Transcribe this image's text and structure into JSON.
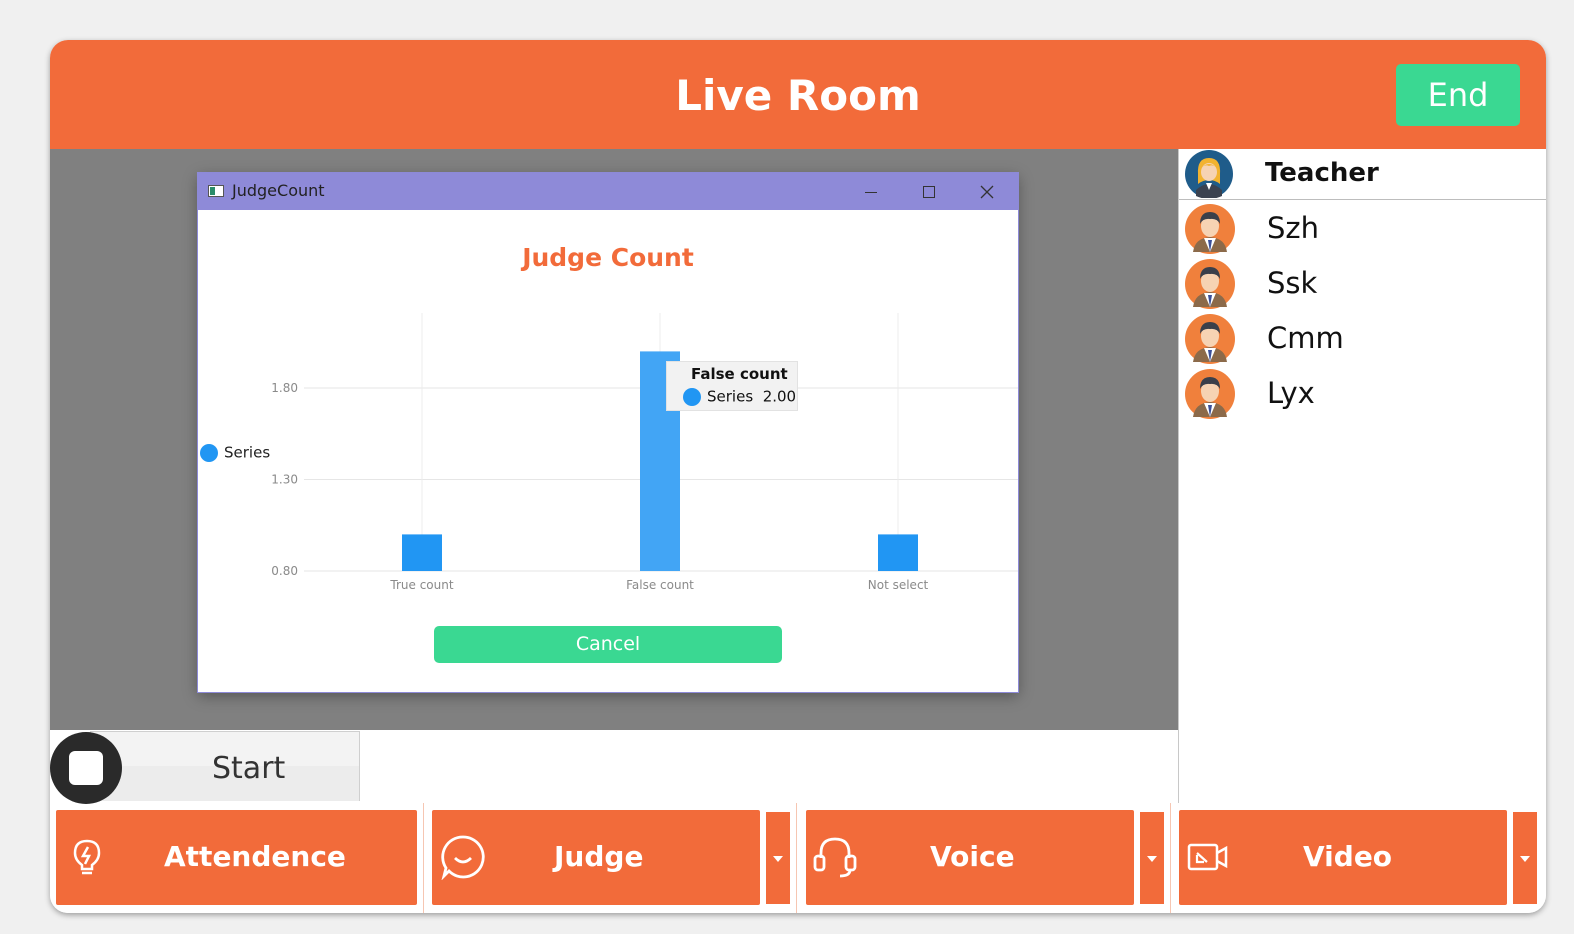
{
  "header": {
    "title": "Live Room",
    "end_label": "End"
  },
  "dialog": {
    "window_title": "JudgeCount",
    "cancel_label": "Cancel"
  },
  "chart_data": {
    "type": "bar",
    "title": "Judge Count",
    "categories": [
      "True count",
      "False count",
      "Not select"
    ],
    "series": [
      {
        "name": "Series",
        "values": [
          1.0,
          2.0,
          1.0
        ],
        "color": "#2196f3"
      }
    ],
    "yticks": [
      "0.80",
      "1.30",
      "1.80"
    ],
    "ylim": [
      0.8,
      1.8
    ],
    "legend": "left",
    "grid": true,
    "tooltip": {
      "title": "False count",
      "series": "Series",
      "value": "2.00"
    }
  },
  "controls": {
    "start_label": "Start"
  },
  "sidebar": {
    "teacher_label": "Teacher",
    "students": [
      "Szh",
      "Ssk",
      "Cmm",
      "Lyx"
    ]
  },
  "toolbar": {
    "attendance_label": "Attendence",
    "judge_label": "Judge",
    "voice_label": "Voice",
    "video_label": "Video"
  },
  "colors": {
    "accent": "#f26b3a",
    "success": "#3ad892",
    "dialog_titlebar": "#8e8ad8",
    "stage": "#808080"
  }
}
